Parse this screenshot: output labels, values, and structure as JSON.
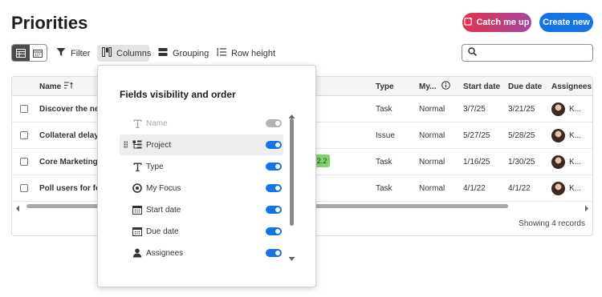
{
  "header": {
    "title": "Priorities",
    "catch_me_up": "Catch me up",
    "create_new": "Create new"
  },
  "toolbar": {
    "filter": "Filter",
    "columns": "Columns",
    "grouping": "Grouping",
    "row_height": "Row height",
    "search_placeholder": ""
  },
  "table": {
    "headers": {
      "name": "Name",
      "type": "Type",
      "my_focus": "My...",
      "start_date": "Start date",
      "due_date": "Due date",
      "assignees": "Assignees"
    },
    "rows": [
      {
        "name": "Discover the new",
        "type": "Task",
        "focus": "Normal",
        "start": "3/7/25",
        "due": "3/21/25",
        "assignee": "K..."
      },
      {
        "name": "Collateral delayed",
        "type": "Issue",
        "focus": "Normal",
        "start": "5/27/25",
        "due": "5/28/25",
        "assignee": "K..."
      },
      {
        "name": "Core Marketing Te",
        "type": "Task",
        "focus": "Normal",
        "start": "1/16/25",
        "due": "1/30/25",
        "assignee": "K..."
      },
      {
        "name": "Poll users for feed",
        "type": "Task",
        "focus": "Normal",
        "start": "4/1/22",
        "due": "4/1/22",
        "assignee": "K..."
      }
    ],
    "pill_label": "2.2",
    "pill_color": "#7fd46e",
    "record_count": "Showing 4 records"
  },
  "columns_popover": {
    "title": "Fields visibility and order",
    "fields": [
      {
        "label": "Name",
        "icon": "text-icon",
        "visible": true,
        "locked": true
      },
      {
        "label": "Project",
        "icon": "project-icon",
        "visible": true,
        "locked": false
      },
      {
        "label": "Type",
        "icon": "text-icon",
        "visible": true,
        "locked": false
      },
      {
        "label": "My Focus",
        "icon": "focus-icon",
        "visible": true,
        "locked": false
      },
      {
        "label": "Start date",
        "icon": "calendar-icon",
        "visible": true,
        "locked": false
      },
      {
        "label": "Due date",
        "icon": "calendar-icon",
        "visible": true,
        "locked": false
      },
      {
        "label": "Assignees",
        "icon": "person-icon",
        "visible": true,
        "locked": false
      }
    ]
  },
  "colors": {
    "accent": "#1473e6",
    "catch_gradient_start": "#e0344d",
    "catch_gradient_end": "#a4479d"
  }
}
